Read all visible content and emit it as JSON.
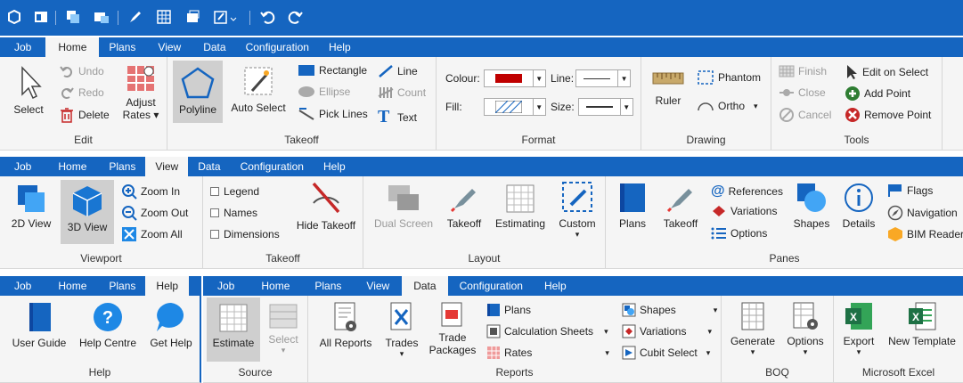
{
  "quickaccess": [
    "app-logo-icon",
    "layout-icon",
    "copy-icon",
    "views-icon",
    "rocket-icon",
    "grid-icon",
    "window-icon",
    "edit-icon",
    "undo-icon",
    "redo-icon"
  ],
  "ribbon1": {
    "tabs": [
      "Job",
      "Home",
      "Plans",
      "View",
      "Data",
      "Configuration",
      "Help"
    ],
    "edit": {
      "label": "Edit",
      "select": "Select",
      "undo": "Undo",
      "redo": "Redo",
      "delete": "Delete",
      "adjust": "Adjust",
      "rates": "Rates"
    },
    "takeoff": {
      "label": "Takeoff",
      "polyline": "Polyline",
      "autoselect": "Auto Select",
      "rectangle": "Rectangle",
      "ellipse": "Ellipse",
      "picklines": "Pick Lines",
      "line": "Line",
      "count": "Count",
      "text": "Text"
    },
    "format": {
      "label": "Format",
      "colour": "Colour:",
      "fill": "Fill:",
      "line": "Line:",
      "size": "Size:",
      "colour_value": "#c00000"
    },
    "drawing": {
      "label": "Drawing",
      "ruler": "Ruler",
      "phantom": "Phantom",
      "ortho": "Ortho"
    },
    "tools": {
      "label": "Tools",
      "finish": "Finish",
      "close": "Close",
      "cancel": "Cancel",
      "editonselect": "Edit on Select",
      "addpoint": "Add Point",
      "removepoint": "Remove Point"
    }
  },
  "ribbon2": {
    "tabs": [
      "Job",
      "Home",
      "Plans",
      "View",
      "Data",
      "Configuration",
      "Help"
    ],
    "viewport": {
      "label": "Viewport",
      "view2d": "2D View",
      "view3d": "3D View",
      "zoomin": "Zoom In",
      "zoomout": "Zoom Out",
      "zoomall": "Zoom All"
    },
    "takeoff": {
      "label": "Takeoff",
      "legend": "Legend",
      "names": "Names",
      "dimensions": "Dimensions",
      "hide": "Hide Takeoff"
    },
    "layout": {
      "label": "Layout",
      "dual": "Dual Screen",
      "takeoff": "Takeoff",
      "estimating": "Estimating",
      "custom": "Custom"
    },
    "panes": {
      "label": "Panes",
      "plans": "Plans",
      "takeoff": "Takeoff",
      "references": "References",
      "variations": "Variations",
      "options": "Options",
      "shapes": "Shapes",
      "details": "Details",
      "flags": "Flags",
      "navigation": "Navigation",
      "bim": "BIM Reader"
    }
  },
  "ribbon3": {
    "tabs": [
      "Job",
      "Home",
      "Plans",
      "Help"
    ],
    "help": {
      "label": "Help",
      "guide": "User Guide",
      "centre": "Help Centre",
      "gethelp": "Get Help"
    }
  },
  "ribbon4": {
    "tabs": [
      "Job",
      "Home",
      "Plans",
      "View",
      "Data",
      "Configuration",
      "Help"
    ],
    "source": {
      "label": "Source",
      "estimate": "Estimate",
      "select": "Select"
    },
    "reports": {
      "label": "Reports",
      "all": "All Reports",
      "trades": "Trades",
      "trade": "Trade",
      "packages": "Packages",
      "plans": "Plans",
      "calc": "Calculation Sheets",
      "rates": "Rates",
      "shapes": "Shapes",
      "variations": "Variations",
      "cubit": "Cubit Select"
    },
    "boq": {
      "label": "BOQ",
      "generate": "Generate",
      "options": "Options"
    },
    "excel": {
      "label": "Microsoft Excel",
      "export": "Export",
      "newtemplate": "New Template"
    }
  }
}
